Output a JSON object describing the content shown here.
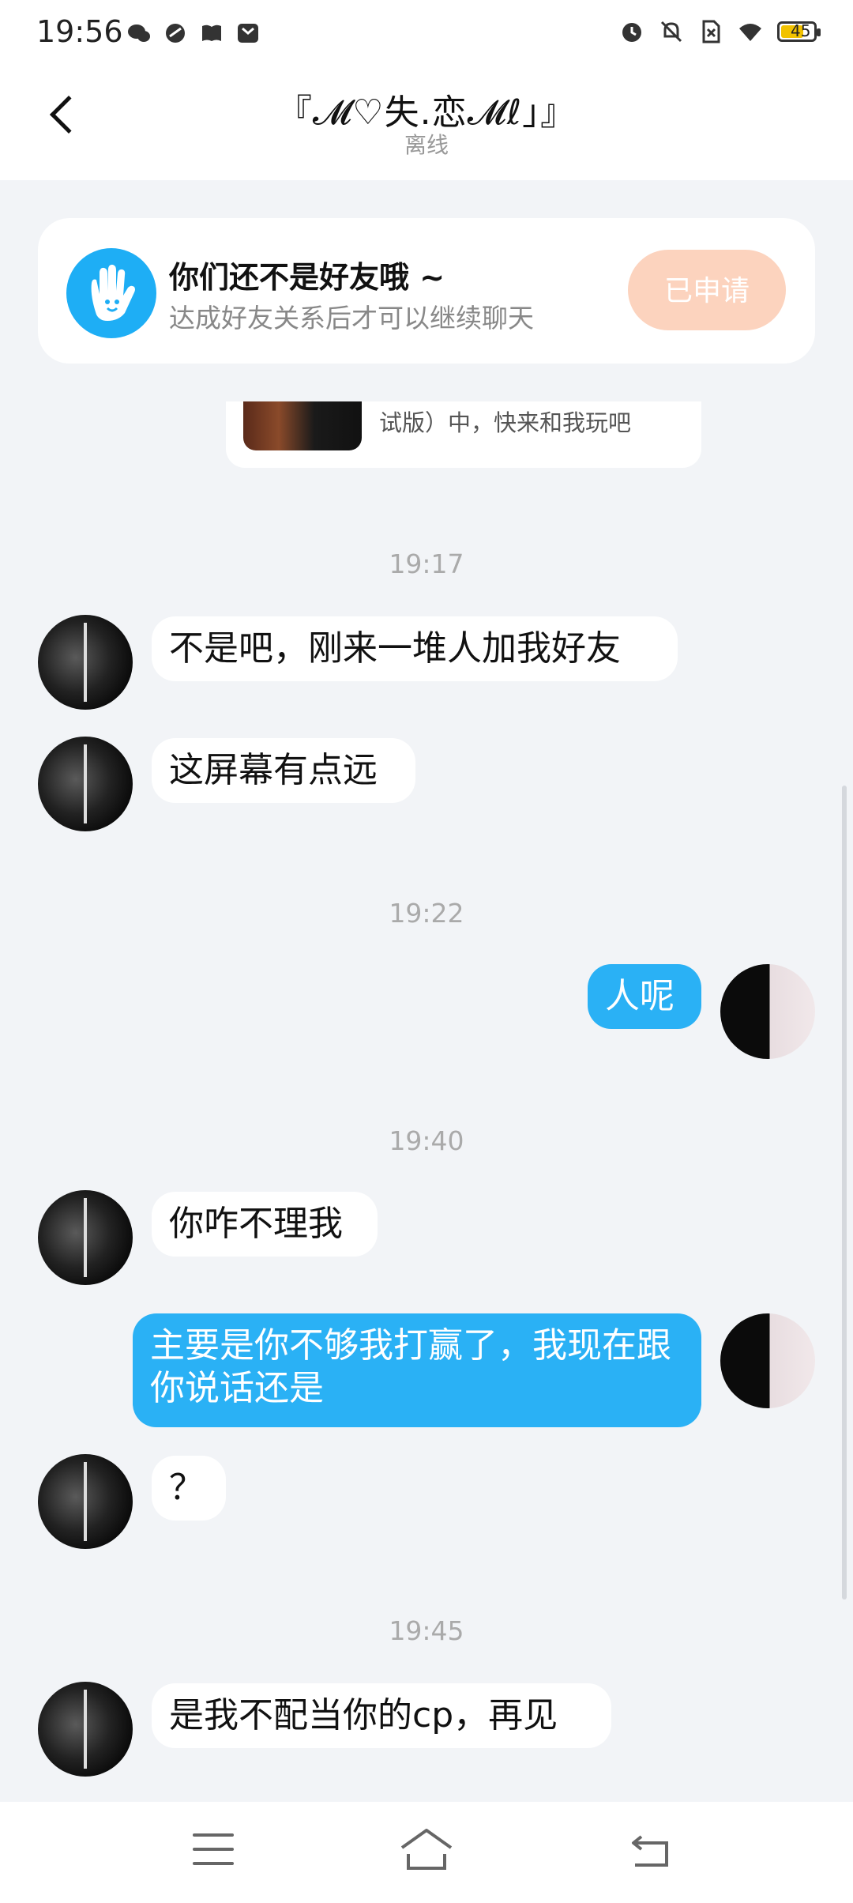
{
  "status_bar": {
    "time": "19:56",
    "battery": "45",
    "left_icons": [
      "wechat-icon",
      "app-icon",
      "book-icon",
      "mail-icon"
    ],
    "right_icons": [
      "alarm-icon",
      "mute-icon",
      "sim-off-icon",
      "wifi-icon",
      "battery-icon"
    ]
  },
  "header": {
    "title": "『𝓜♡失.恋𝓜ℓ」』",
    "subtitle": "离线"
  },
  "notice": {
    "title": "你们还不是好友哦 ~",
    "subtitle": "达成好友关系后才可以继续聊天",
    "button": "已申请"
  },
  "game_card": {
    "text": "试版）中，快来和我玩吧"
  },
  "messages": [
    {
      "type": "time",
      "text": "19:17"
    },
    {
      "type": "in",
      "text": "不是吧，刚来一堆人加我好友"
    },
    {
      "type": "in",
      "text": "这屏幕有点远"
    },
    {
      "type": "time",
      "text": "19:22"
    },
    {
      "type": "out",
      "text": "人呢"
    },
    {
      "type": "time",
      "text": "19:40"
    },
    {
      "type": "in",
      "text": "你咋不理我"
    },
    {
      "type": "out",
      "text": "主要是你不够我打赢了，我现在跟你说话还是"
    },
    {
      "type": "in",
      "text": "？"
    },
    {
      "type": "time",
      "text": "19:45"
    },
    {
      "type": "in",
      "text": "是我不配当你的cp，再见"
    }
  ],
  "colors": {
    "accent": "#2ab1f5",
    "background": "#f2f4f7",
    "applied_button": "#fcd3be"
  }
}
